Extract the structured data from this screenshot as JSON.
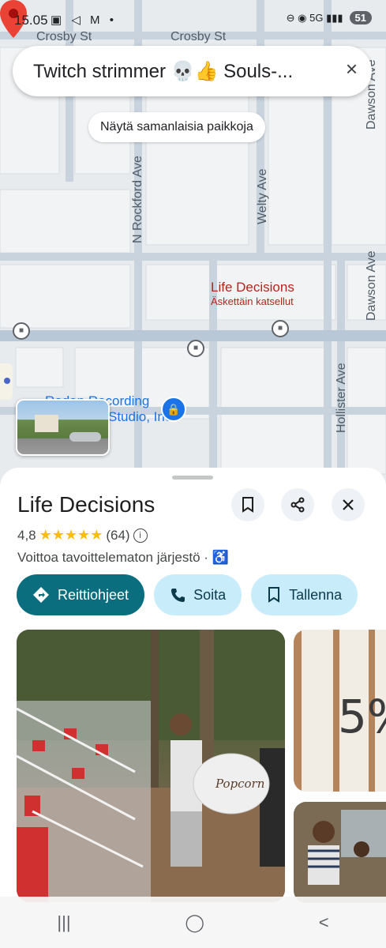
{
  "status_bar": {
    "time": "15.05",
    "left_icons": "▣ ◁ M •",
    "right_icons": "⊖ ◉ 5G ▮▮▮",
    "battery": "51"
  },
  "map": {
    "streets": {
      "crosby1": "Crosby St",
      "crosby2": "Crosby St",
      "rockford": "N Rockford Ave",
      "welty": "Welty Ave",
      "dawson1": "Dawson Ave",
      "dawson2": "Dawson Ave",
      "hollister": "Hollister Ave"
    },
    "pin": {
      "name": "Life Decisions",
      "subtitle": "Äskettäin katsellut"
    },
    "poi": {
      "label_line1": "Rodan Recording",
      "label_line2": "Studio, Inc"
    }
  },
  "search": {
    "query": "Twitch strimmer 💀👍 Souls-...",
    "close_icon": "×"
  },
  "similar_places": "Näytä samanlaisia paikkoja",
  "place": {
    "title": "Life Decisions",
    "rating": "4,8",
    "stars": "★★★★★",
    "review_count": "(64)",
    "category": "Voittoa tavoittelematon järjestö ·",
    "accessibility_icon": "♿"
  },
  "actions": {
    "directions": "Reittiohjeet",
    "call": "Soita",
    "save": "Tallenna"
  },
  "photos": {
    "side_sign_text": "5%",
    "main_sign_text": "Popcorn"
  },
  "nav": {
    "recent": "|||",
    "home": "◯",
    "back": "<"
  },
  "colors": {
    "primary": "#0b6e7e",
    "secondary_chip": "#c9ecfb",
    "pin_red": "#b3261e",
    "poi_blue": "#1a73e8"
  }
}
